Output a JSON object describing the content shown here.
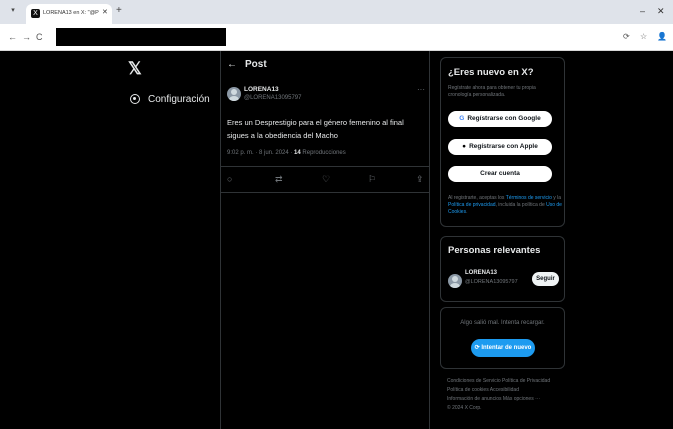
{
  "browser": {
    "tab_menu_icon": "▾",
    "tab_favicon": "X",
    "tab_title": "LORENA13 en X: \"@PRamirez-",
    "tab_close": "✕",
    "new_tab": "+",
    "minimize": "–",
    "close": "✕",
    "back": "←",
    "forward": "→",
    "reload": "C",
    "ext_icons": [
      "⟳",
      "☆",
      "👤"
    ]
  },
  "left_nav": {
    "logo": "𝕏",
    "items": [
      {
        "label": "Configuración",
        "icon": "gear-icon"
      }
    ]
  },
  "post": {
    "header_back": "←",
    "header_title": "Post",
    "author_name": "LORENA13",
    "author_handle": "@LORENA13095797",
    "more": "···",
    "text": "Eres un Desprestigio para el género femenino al final sigues a la obediencia del Macho",
    "time": "9:02 p. m. · 8 jun. 2024 · ",
    "views_count": "14",
    "views_label": " Reproducciones",
    "actions": [
      "○",
      "⇄",
      "♡",
      "⚐",
      "⇪"
    ]
  },
  "signup": {
    "title": "¿Eres nuevo en X?",
    "subtitle": "Regístrate ahora para obtener tu propia cronología personalizada.",
    "google_label": "Regístrarse con Google",
    "apple_label": "Regístrarse con Apple",
    "create_label": "Crear cuenta",
    "terms_prefix": "Al registrarte, aceptas los ",
    "terms_link": "Términos de servicio",
    "terms_mid1": " y la ",
    "privacy_link": "Política de privacidad",
    "terms_mid2": ", incluida la política de ",
    "cookies_link": "Uso de Cookies",
    "terms_end": "."
  },
  "people": {
    "title": "Personas relevantes",
    "name": "LORENA13",
    "handle": "@LORENA13095797",
    "follow_label": "Seguir"
  },
  "error": {
    "text": "Algo salió mal. Intenta recargar.",
    "retry_label": "Intentar de nuevo"
  },
  "footer": {
    "line1": "Condiciones de Servicio   Política de Privacidad",
    "line2": "Política de cookies   Accesibilidad",
    "line3": "Información de anuncios   Más opciones ···",
    "line4": "© 2024 X Corp."
  },
  "colors": {
    "background": "#000000",
    "accent": "#1d9bf0",
    "border": "#2f3336",
    "muted": "#71767b"
  }
}
